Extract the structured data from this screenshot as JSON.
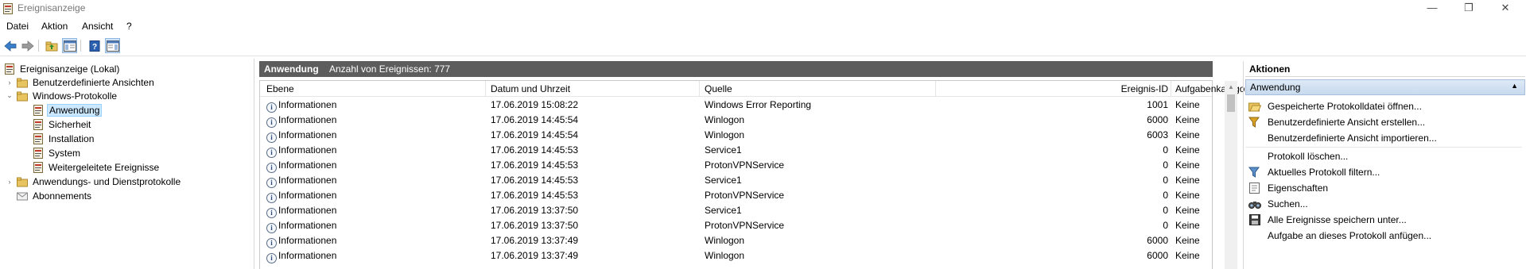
{
  "window": {
    "title": "Ereignisanzeige",
    "minimize": "—",
    "restore": "❐",
    "close": "✕"
  },
  "menu": [
    "Datei",
    "Aktion",
    "Ansicht",
    "?"
  ],
  "tree": {
    "root": "Ereignisanzeige (Lokal)",
    "custom_views": "Benutzerdefinierte Ansichten",
    "windows_logs": "Windows-Protokolle",
    "logs": [
      "Anwendung",
      "Sicherheit",
      "Installation",
      "System",
      "Weitergeleitete Ereignisse"
    ],
    "app_service_logs": "Anwendungs- und Dienstprotokolle",
    "subscriptions": "Abonnements"
  },
  "center": {
    "log_name": "Anwendung",
    "event_count": "Anzahl von Ereignissen: 777",
    "columns": {
      "level": "Ebene",
      "datetime": "Datum und Uhrzeit",
      "source": "Quelle",
      "event_id": "Ereignis-ID",
      "task": "Aufgabenkategorie"
    },
    "rows": [
      {
        "level": "Informationen",
        "datetime": "17.06.2019 15:08:22",
        "source": "Windows Error Reporting",
        "event_id": "1001",
        "task": "Keine"
      },
      {
        "level": "Informationen",
        "datetime": "17.06.2019 14:45:54",
        "source": "Winlogon",
        "event_id": "6000",
        "task": "Keine"
      },
      {
        "level": "Informationen",
        "datetime": "17.06.2019 14:45:54",
        "source": "Winlogon",
        "event_id": "6003",
        "task": "Keine"
      },
      {
        "level": "Informationen",
        "datetime": "17.06.2019 14:45:53",
        "source": "Service1",
        "event_id": "0",
        "task": "Keine"
      },
      {
        "level": "Informationen",
        "datetime": "17.06.2019 14:45:53",
        "source": "ProtonVPNService",
        "event_id": "0",
        "task": "Keine"
      },
      {
        "level": "Informationen",
        "datetime": "17.06.2019 14:45:53",
        "source": "Service1",
        "event_id": "0",
        "task": "Keine"
      },
      {
        "level": "Informationen",
        "datetime": "17.06.2019 14:45:53",
        "source": "ProtonVPNService",
        "event_id": "0",
        "task": "Keine"
      },
      {
        "level": "Informationen",
        "datetime": "17.06.2019 13:37:50",
        "source": "Service1",
        "event_id": "0",
        "task": "Keine"
      },
      {
        "level": "Informationen",
        "datetime": "17.06.2019 13:37:50",
        "source": "ProtonVPNService",
        "event_id": "0",
        "task": "Keine"
      },
      {
        "level": "Informationen",
        "datetime": "17.06.2019 13:37:49",
        "source": "Winlogon",
        "event_id": "6000",
        "task": "Keine"
      },
      {
        "level": "Informationen",
        "datetime": "17.06.2019 13:37:49",
        "source": "Winlogon",
        "event_id": "6000",
        "task": "Keine"
      }
    ]
  },
  "actions": {
    "header": "Aktionen",
    "section": "Anwendung",
    "items": [
      {
        "label": "Gespeicherte Protokolldatei öffnen...",
        "icon": "open-folder-icon"
      },
      {
        "label": "Benutzerdefinierte Ansicht erstellen...",
        "icon": "filter-create-icon"
      },
      {
        "label": "Benutzerdefinierte Ansicht importieren...",
        "icon": ""
      },
      {
        "label": "Protokoll löschen...",
        "icon": ""
      },
      {
        "label": "Aktuelles Protokoll filtern...",
        "icon": "filter-icon"
      },
      {
        "label": "Eigenschaften",
        "icon": "properties-icon"
      },
      {
        "label": "Suchen...",
        "icon": "binoculars-icon"
      },
      {
        "label": "Alle Ereignisse speichern unter...",
        "icon": "save-icon"
      },
      {
        "label": "Aufgabe an dieses Protokoll anfügen...",
        "icon": ""
      }
    ]
  }
}
